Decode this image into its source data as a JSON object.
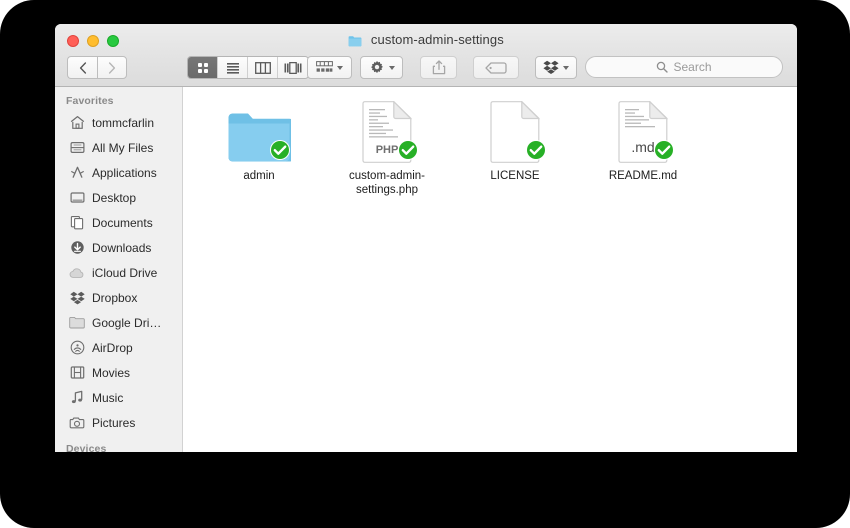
{
  "window": {
    "title": "custom-admin-settings",
    "title_icon": "folder-icon",
    "traffic_lights": {
      "close_label": "Close",
      "minimize_label": "Minimize",
      "maximize_label": "Maximize"
    }
  },
  "toolbar": {
    "back_label": "‹",
    "forward_label": "›",
    "view_modes": [
      {
        "name": "icon-view",
        "label": "Icon view",
        "active": true
      },
      {
        "name": "list-view",
        "label": "List view",
        "active": false
      },
      {
        "name": "column-view",
        "label": "Column view",
        "active": false
      },
      {
        "name": "coverflow-view",
        "label": "Cover Flow view",
        "active": false
      }
    ],
    "arrange_label": "Arrange",
    "action_label": "Action",
    "share_label": "Share",
    "tag_label": "Tags",
    "dropbox_label": "Dropbox"
  },
  "search": {
    "placeholder": "Search",
    "value": "",
    "icon": "search-icon"
  },
  "sidebar": {
    "sections": [
      {
        "header": "Favorites",
        "items": [
          {
            "label": "tommcfarlin",
            "icon": "home-icon"
          },
          {
            "label": "All My Files",
            "icon": "all-my-files-icon"
          },
          {
            "label": "Applications",
            "icon": "applications-icon"
          },
          {
            "label": "Desktop",
            "icon": "desktop-icon"
          },
          {
            "label": "Documents",
            "icon": "documents-icon"
          },
          {
            "label": "Downloads",
            "icon": "downloads-icon"
          },
          {
            "label": "iCloud Drive",
            "icon": "cloud-icon"
          },
          {
            "label": "Dropbox",
            "icon": "dropbox-icon"
          },
          {
            "label": "Google Dri…",
            "icon": "folder-icon"
          },
          {
            "label": "AirDrop",
            "icon": "airdrop-icon"
          },
          {
            "label": "Movies",
            "icon": "movies-icon"
          },
          {
            "label": "Music",
            "icon": "music-icon"
          },
          {
            "label": "Pictures",
            "icon": "pictures-icon"
          }
        ]
      },
      {
        "header": "Devices",
        "items": []
      }
    ]
  },
  "files": [
    {
      "name": "admin",
      "kind": "folder",
      "badge": "synced-check",
      "icon_text": ""
    },
    {
      "name": "custom-admin-settings.php",
      "kind": "php-document",
      "badge": "synced-check",
      "icon_text": "PHP"
    },
    {
      "name": "LICENSE",
      "kind": "blank-document",
      "badge": "synced-check",
      "icon_text": ""
    },
    {
      "name": "README.md",
      "kind": "markdown-document",
      "badge": "synced-check",
      "icon_text": ".md"
    }
  ],
  "colors": {
    "folder_blue": "#7ec8ef",
    "badge_green": "#27b026",
    "toolbar_grey": "#e6e6e6",
    "sidebar_grey": "#f0f0f0",
    "backdrop": "#000000"
  }
}
